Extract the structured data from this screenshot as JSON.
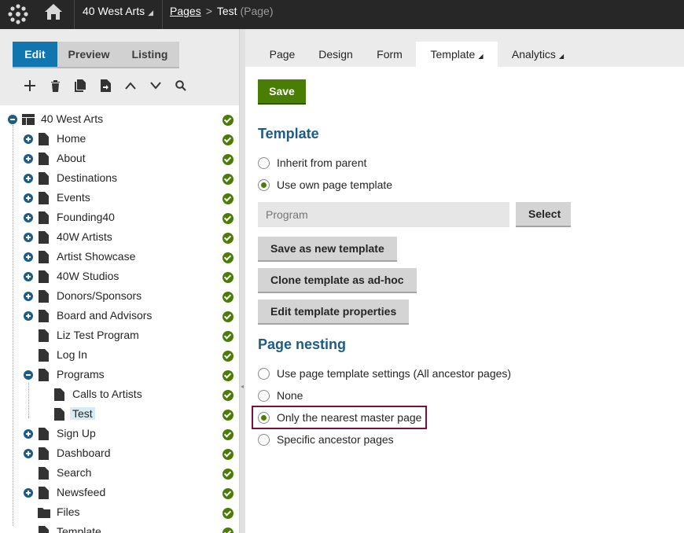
{
  "topbar": {
    "site_name": "40 West Arts",
    "breadcrumb_pages": "Pages",
    "breadcrumb_current": "Test",
    "breadcrumb_type": "(Page)"
  },
  "modes": {
    "edit": "Edit",
    "preview": "Preview",
    "listing": "Listing"
  },
  "tree": {
    "root": "40 West Arts",
    "items": [
      "Home",
      "About",
      "Destinations",
      "Events",
      "Founding40",
      "40W Artists",
      "Artist Showcase",
      "40W Studios",
      "Donors/Sponsors",
      "Board and Advisors",
      "Liz Test Program",
      "Log In",
      "Programs",
      "Calls to Artists",
      "Test",
      "Sign Up",
      "Dashboard",
      "Search",
      "Newsfeed",
      "Files",
      "Template"
    ]
  },
  "page_tabs": {
    "page": "Page",
    "design": "Design",
    "form": "Form",
    "template": "Template",
    "analytics": "Analytics"
  },
  "content": {
    "save_label": "Save",
    "template_heading": "Template",
    "inherit_label": "Inherit from parent",
    "own_template_label": "Use own page template",
    "template_value": "Program",
    "select_label": "Select",
    "save_new_label": "Save as new template",
    "clone_label": "Clone template as ad-hoc",
    "edit_props_label": "Edit template properties",
    "nesting_heading": "Page nesting",
    "nesting_opt1": "Use page template settings (All ancestor pages)",
    "nesting_opt2": "None",
    "nesting_opt3": "Only the nearest master page",
    "nesting_opt4": "Specific ancestor pages"
  },
  "colors": {
    "accent_blue": "#1175ae",
    "heading_blue": "#1c5c86",
    "save_green": "#497d04",
    "highlight": "#7a0f3c",
    "topbar": "#272727"
  }
}
